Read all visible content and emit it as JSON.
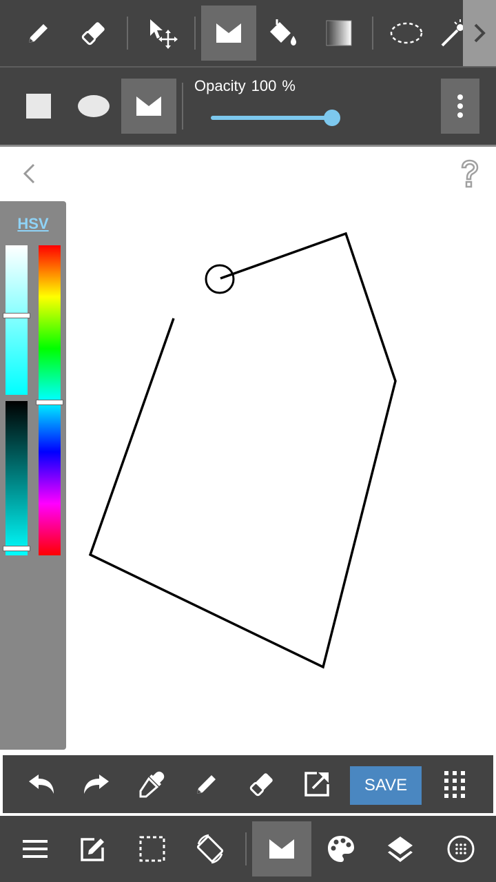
{
  "toolbar_top": {
    "tools": [
      {
        "icon": "pencil-icon",
        "label": ""
      },
      {
        "icon": "eraser-icon",
        "label": ""
      },
      {
        "icon": "move-icon",
        "label": ""
      },
      {
        "icon": "shape-tool-icon",
        "label": ""
      },
      {
        "icon": "fill-bucket-icon",
        "label": ""
      },
      {
        "icon": "gradient-icon",
        "label": ""
      },
      {
        "icon": "lasso-select-icon",
        "label": ""
      },
      {
        "icon": "magic-wand-icon",
        "label": ""
      }
    ],
    "active_tool": "shape-tool-icon",
    "expand_icon": "chevron-right-icon"
  },
  "toolbar_options": {
    "shapes": [
      "rectangle-shape-icon",
      "ellipse-shape-icon",
      "polygon-shape-icon"
    ],
    "active_shape": "polygon-shape-icon",
    "opacity_label": "Opacity",
    "opacity_value": "100",
    "opacity_unit": "%",
    "opacity_fraction": 1.0,
    "menu_icon": "more-vertical-icon"
  },
  "canvas": {
    "back_icon": "chevron-left-icon",
    "help_icon": "help-icon"
  },
  "color_panel": {
    "mode_label": "HSV",
    "current_color": "#00ffff",
    "saturation_fraction": 0.48,
    "hue_fraction": 0.5,
    "value_fraction": 1.0
  },
  "toolbar_actions": {
    "save_label": "SAVE",
    "icons": [
      "undo-icon",
      "redo-icon",
      "eyedropper-icon",
      "pen-icon",
      "eraser-icon",
      "export-icon",
      "grid-menu-icon"
    ]
  },
  "toolbar_bottom": {
    "icons": [
      "hamburger-menu-icon",
      "edit-icon",
      "selection-icon",
      "rotate-canvas-icon",
      "shape-tool-icon",
      "palette-icon",
      "layers-icon",
      "dot-grid-icon"
    ],
    "active": "shape-tool-icon"
  },
  "colors": {
    "toolbar_bg": "#434343",
    "active_bg": "#6a6a6a",
    "accent": "#7dc8ee",
    "save_button": "#4a87c1",
    "panel_bg": "#878787"
  }
}
